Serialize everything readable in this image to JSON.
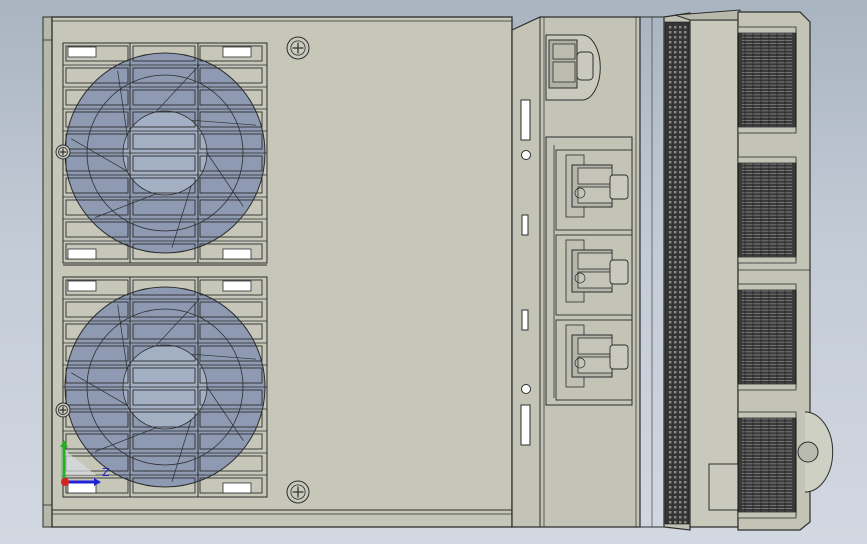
{
  "viewport": {
    "background_top": "#a9b4c1",
    "background_bottom": "#d2d8e1"
  },
  "model": {
    "body_color": "#c6c7b9",
    "edge_color": "#2d2d2d",
    "grille_hole_color": "#95a1b8",
    "fan_color": "#8d9ab2",
    "fan_units": 2,
    "cable_glands": 3,
    "connectors": 4
  },
  "triad": {
    "axis_z_label": "Z",
    "x_color": "#d52121",
    "y_color": "#21b121",
    "z_color": "#2121d5"
  }
}
